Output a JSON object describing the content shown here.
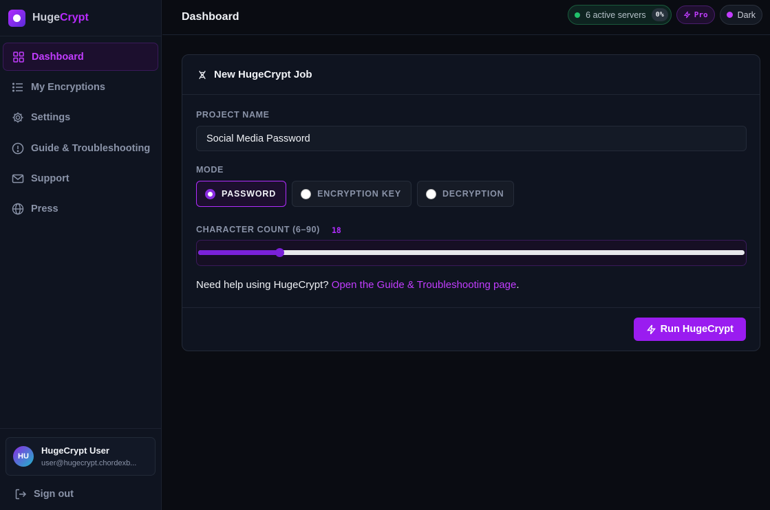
{
  "brand": {
    "name_part1": "Huge",
    "name_part2": "Crypt"
  },
  "sidebar": {
    "items": [
      {
        "label": "Dashboard",
        "icon": "grid-icon",
        "active": true
      },
      {
        "label": "My Encryptions",
        "icon": "list-icon",
        "active": false
      },
      {
        "label": "Settings",
        "icon": "gear-icon",
        "active": false
      },
      {
        "label": "Guide & Troubleshooting",
        "icon": "alert-circle-icon",
        "active": false
      },
      {
        "label": "Support",
        "icon": "mail-icon",
        "active": false
      },
      {
        "label": "Press",
        "icon": "globe-icon",
        "active": false
      }
    ]
  },
  "user": {
    "initials": "HU",
    "name": "HugeCrypt User",
    "email": "user@hugecrypt.chordexb..."
  },
  "signout_label": "Sign out",
  "header": {
    "title": "Dashboard",
    "servers_label": "6 active servers",
    "servers_pct": "0%",
    "pro_label": "Pro",
    "theme_label": "Dark"
  },
  "job": {
    "title": "New HugeCrypt Job",
    "project_label": "PROJECT NAME",
    "project_value": "Social Media Password",
    "mode_label": "MODE",
    "modes": [
      {
        "label": "PASSWORD",
        "selected": true
      },
      {
        "label": "ENCRYPTION KEY",
        "selected": false
      },
      {
        "label": "DECRYPTION",
        "selected": false
      }
    ],
    "char_label": "CHARACTER COUNT (6–90)",
    "char_value": "18",
    "char_min": 6,
    "char_max": 90,
    "help_text": "Need help using HugeCrypt? ",
    "help_link": "Open the Guide & Troubleshooting page",
    "help_end": ".",
    "run_label": "Run HugeCrypt"
  },
  "colors": {
    "accent": "#b92bff",
    "button": "#9a1cf0",
    "status_green": "#21c16b"
  }
}
